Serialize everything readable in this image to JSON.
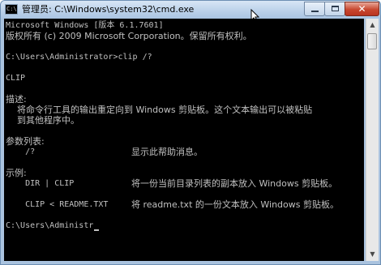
{
  "window": {
    "title": "管理员: C:\\Windows\\system32\\cmd.exe",
    "icon": "cmd-icon",
    "icon_glyph": "C:\\"
  },
  "controls": {
    "minimize": "minimize-icon",
    "maximize": "maximize-icon",
    "close_label": "✕"
  },
  "console": {
    "lines": [
      "Microsoft Windows [版本 6.1.7601]",
      "版权所有 (c) 2009 Microsoft Corporation。保留所有权利。",
      "C:\\Users\\Administrator>clip /?",
      "CLIP",
      "描述:",
      "    将命令行工具的输出重定向到 Windows 剪贴板。这个文本输出可以被粘贴",
      "    到其他程序中。",
      "参数列表:",
      "    /?",
      "示例:",
      "    DIR | CLIP",
      "    CLIP < README.TXT",
      "C:\\Users\\Administr"
    ],
    "param_help": "显示此帮助消息。",
    "example1_desc": "将一份当前目录列表的副本放入 Windows 剪贴板。",
    "example2_desc": "将 readme.txt 的一份文本放入 Windows 剪贴板。"
  },
  "colors": {
    "console_bg": "#000000",
    "console_fg": "#c0c0c0",
    "close_button": "#c8472f",
    "frame": "#aac3df"
  }
}
